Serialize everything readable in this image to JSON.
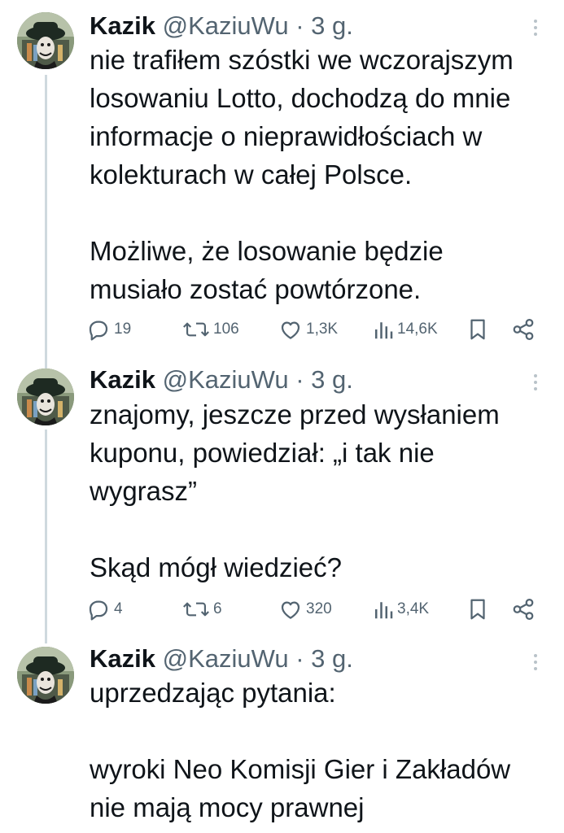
{
  "tweets": [
    {
      "author": {
        "name": "Kazik",
        "handle": "@KaziuWu",
        "separator": "·",
        "time": "3 g."
      },
      "text_lines": [
        "nie trafiłem szóstki we wczorajszym",
        "losowaniu Lotto, dochodzą do mnie",
        "informacje o nieprawidłościach w",
        "kolekturach w całej Polsce.",
        "",
        "Możliwe, że losowanie będzie",
        "musiało zostać powtórzone."
      ],
      "actions": {
        "replies": "19",
        "reposts": "106",
        "likes": "1,3K",
        "views": "14,6K"
      }
    },
    {
      "author": {
        "name": "Kazik",
        "handle": "@KaziuWu",
        "separator": "·",
        "time": "3 g."
      },
      "text_lines": [
        "znajomy, jeszcze przed wysłaniem",
        "kuponu, powiedział: „i tak nie",
        "wygrasz”",
        "",
        "Skąd mógł wiedzieć?"
      ],
      "actions": {
        "replies": "4",
        "reposts": "6",
        "likes": "320",
        "views": "3,4K"
      }
    },
    {
      "author": {
        "name": "Kazik",
        "handle": "@KaziuWu",
        "separator": "·",
        "time": "3 g."
      },
      "text_lines": [
        "uprzedzając pytania:",
        "",
        "wyroki Neo Komisji Gier i Zakładów",
        "nie mają mocy prawnej"
      ]
    }
  ],
  "icons": {
    "reply": "reply-icon",
    "repost": "repost-icon",
    "like": "like-icon",
    "views": "views-icon",
    "bookmark": "bookmark-icon",
    "share": "share-icon",
    "more": "more-icon"
  },
  "colors": {
    "text": "#0f1419",
    "secondary": "#536471",
    "thread_line": "#cfd9de"
  }
}
